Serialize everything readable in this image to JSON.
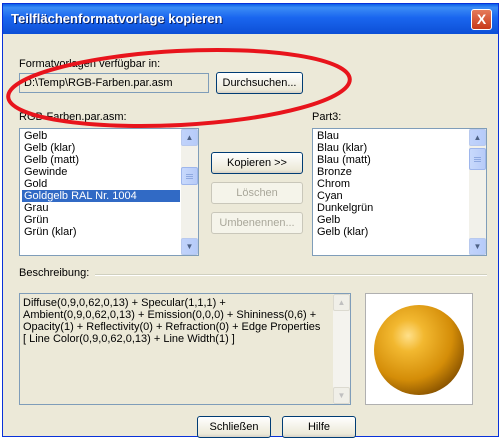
{
  "window": {
    "title": "Teilflächenformatvorlage kopieren",
    "close_glyph": "X"
  },
  "source": {
    "label": "Formatvorlagen verfügbar in:",
    "path": "D:\\Temp\\RGB-Farben.par.asm",
    "browse_label": "Durchsuchen..."
  },
  "left_list": {
    "label": "RGB-Farben.par.asm:",
    "items": [
      "Gelb",
      "Gelb (klar)",
      "Gelb (matt)",
      "Gewinde",
      "Gold",
      "Goldgelb RAL Nr. 1004",
      "Grau",
      "Grün",
      "Grün (klar)"
    ],
    "selected_index": 5
  },
  "right_list": {
    "label": "Part3:",
    "items": [
      "Blau",
      "Blau (klar)",
      "Blau (matt)",
      "Bronze",
      "Chrom",
      "Cyan",
      "Dunkelgrün",
      "Gelb",
      "Gelb (klar)"
    ]
  },
  "actions": {
    "copy_label": "Kopieren >>",
    "delete_label": "Löschen",
    "rename_label": "Umbenennen..."
  },
  "description": {
    "label": "Beschreibung:",
    "text": "Diffuse(0,9,0,62,0,13) + Specular(1,1,1) +\nAmbient(0,9,0,62,0,13) + Emission(0,0,0) + Shininess(0,6) +\nOpacity(1) + Reflectivity(0) + Refraction(0) + Edge Properties\n[ Line Color(0,9,0,62,0,13) + Line Width(1) ]"
  },
  "footer": {
    "close_label": "Schließen",
    "help_label": "Hilfe"
  },
  "colors": {
    "title_bar": "#0a5ee8",
    "selection": "#316ac5",
    "sphere": "#e6a412",
    "annotation": "#e8141c"
  },
  "icons": {
    "scroll_up": "▲",
    "scroll_down": "▼"
  }
}
